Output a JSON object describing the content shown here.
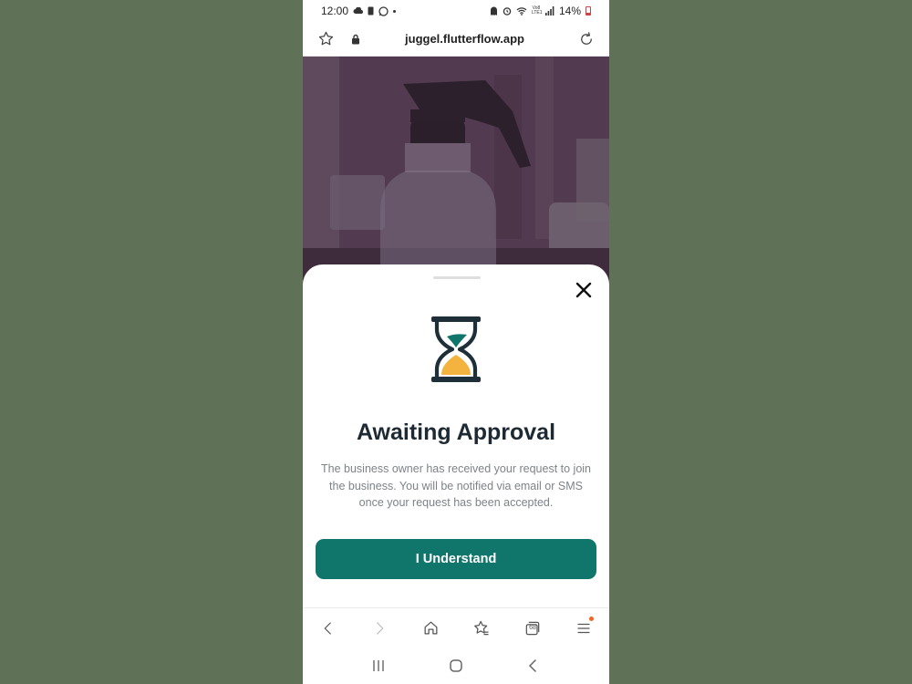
{
  "status_bar": {
    "time": "12:00",
    "battery": "14%",
    "left_icons": [
      "cloud-icon",
      "sim-icon",
      "whatsapp-icon",
      "dot-icon"
    ],
    "right_icons": [
      "ghost-icon",
      "alarm-icon",
      "wifi-icon",
      "volte-icon",
      "signal-icon",
      "battery-icon"
    ],
    "network_label": "Vo8 LTE1"
  },
  "browser": {
    "url": "juggel.flutterflow.app",
    "icons": [
      "star-icon",
      "lock-icon",
      "reload-icon"
    ]
  },
  "sheet": {
    "icon": "hourglass-icon",
    "title": "Awaiting Approval",
    "description": "The business owner has received your request to join the business. You will be notified via email or SMS once your request has been accepted.",
    "button_label": "I Understand",
    "close_icon": "close-icon"
  },
  "toolbar": {
    "items": [
      "back-icon",
      "forward-icon",
      "home-icon",
      "bookmarks-icon",
      "tabs-icon",
      "menu-icon"
    ],
    "tab_count": "68"
  },
  "android_nav": {
    "items": [
      "recents-icon",
      "home-circle-icon",
      "back-icon"
    ]
  },
  "colors": {
    "background": "#5f7156",
    "primary": "#10766c",
    "hourglass_teal": "#10766c",
    "hourglass_sand": "#f4b33f",
    "hourglass_frame": "#1e2f3a",
    "title": "#1e2a33",
    "body_text": "#7e8389"
  }
}
